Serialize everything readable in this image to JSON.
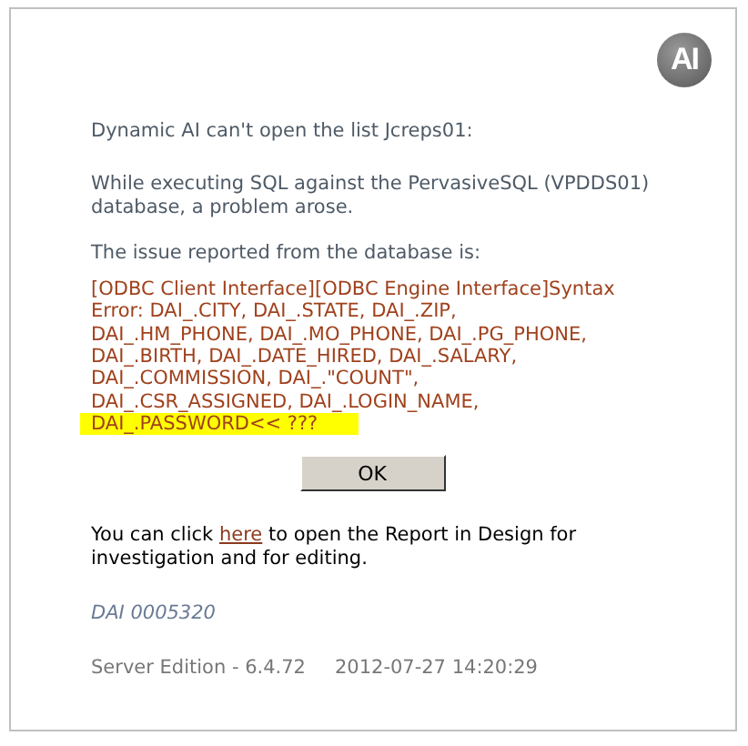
{
  "logo": {
    "text": "AI"
  },
  "heading": "Dynamic AI can't open the list Jcreps01:",
  "description_lines": [
    "While executing SQL against the PervasiveSQL (VPDDS01)",
    "database, a problem arose."
  ],
  "issue_intro": "The issue reported from the database is:",
  "error_lines": [
    {
      "text": "[ODBC Client Interface][ODBC Engine Interface]Syntax",
      "highlighted": false
    },
    {
      "text": "Error: DAI_.CITY, DAI_.STATE, DAI_.ZIP,",
      "highlighted": false
    },
    {
      "text": "DAI_.HM_PHONE, DAI_.MO_PHONE, DAI_.PG_PHONE,",
      "highlighted": false
    },
    {
      "text": "DAI_.BIRTH, DAI_.DATE_HIRED, DAI_.SALARY,",
      "highlighted": false
    },
    {
      "text": "DAI_.COMMISSION, DAI_.\"COUNT\",",
      "highlighted": false
    },
    {
      "text": "DAI_.CSR_ASSIGNED, DAI_.LOGIN_NAME,",
      "highlighted": false
    },
    {
      "text": "DAI_.PASSWORD<< ???",
      "highlighted": true
    }
  ],
  "ok_button": "OK",
  "design_note": {
    "before": "You can click",
    "link": "here",
    "after": "to open the Report in Design for",
    "line_2": "investigation and for editing."
  },
  "error_code": "DAI 0005320",
  "footer": {
    "edition": "Server Edition - 6.4.72",
    "timestamp": "2012-07-27 14:20:29"
  }
}
